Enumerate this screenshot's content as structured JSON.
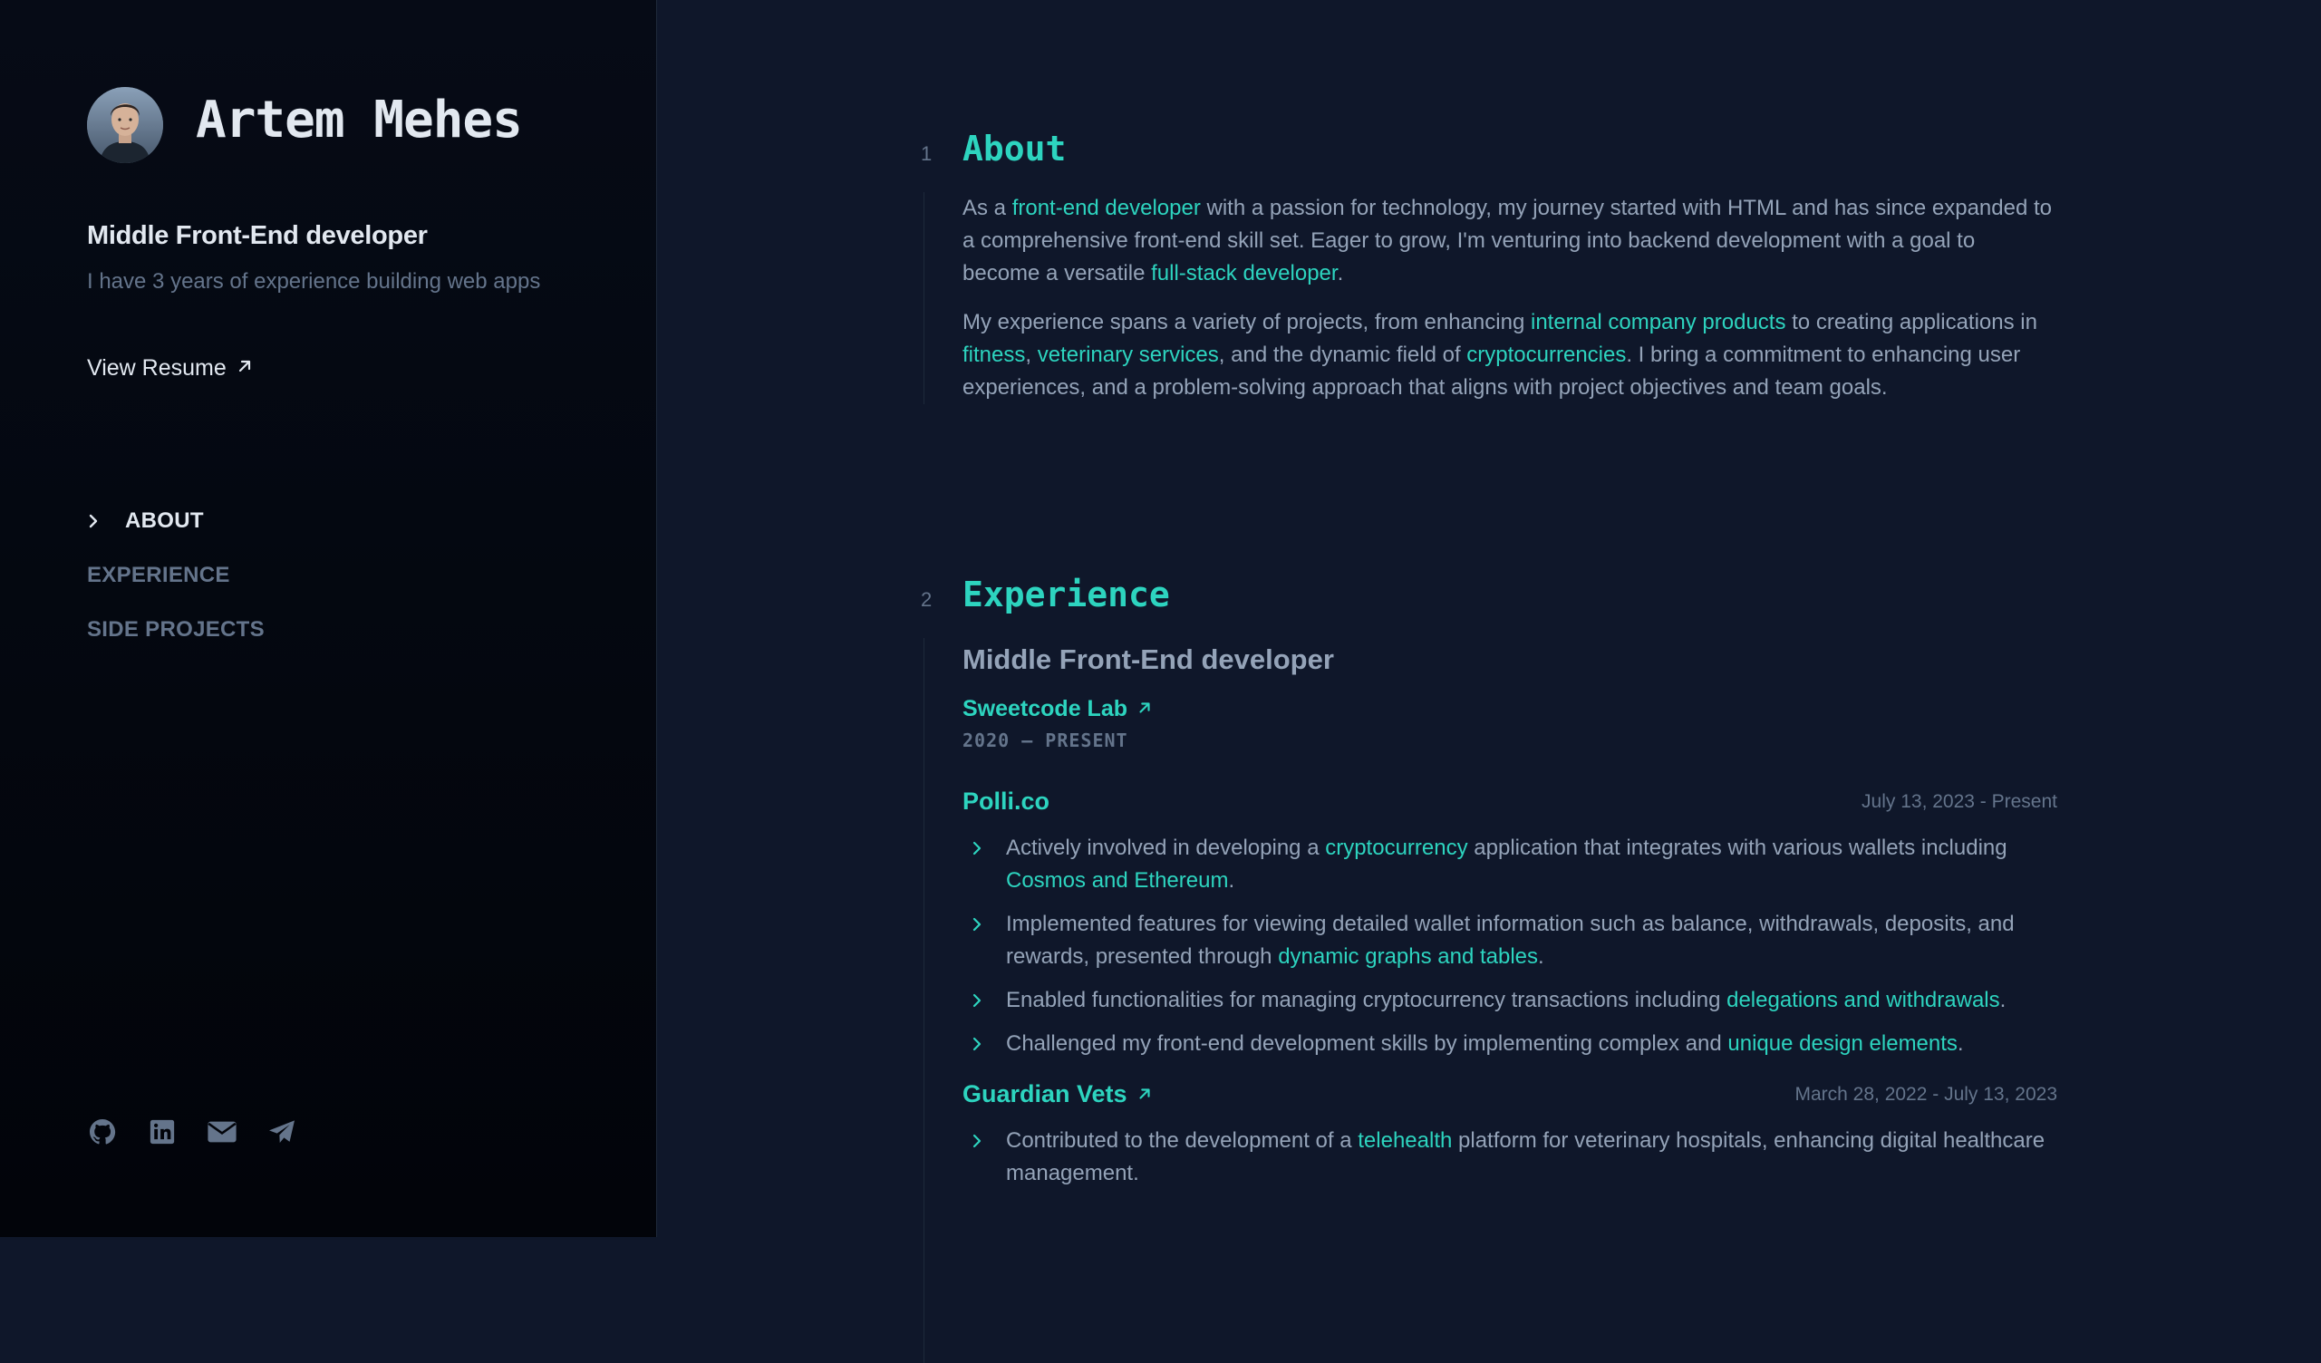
{
  "sidebar": {
    "name": "Artem Mehes",
    "role": "Middle Front-End developer",
    "tagline": "I have 3 years of experience building web apps",
    "resume_label": "View Resume",
    "nav": [
      {
        "label": "ABOUT",
        "active": true
      },
      {
        "label": "EXPERIENCE",
        "active": false
      },
      {
        "label": "SIDE PROJECTS",
        "active": false
      }
    ],
    "socials": [
      "github-icon",
      "linkedin-icon",
      "email-icon",
      "telegram-icon"
    ]
  },
  "about": {
    "number": "1",
    "title": "About",
    "p1": {
      "a": "As a ",
      "b": "front-end developer",
      "c": " with a passion for technology, my journey started with HTML and has since expanded to a comprehensive front-end skill set. Eager to grow, I'm venturing into backend development with a goal to become a versatile ",
      "d": "full-stack developer",
      "e": "."
    },
    "p2": {
      "a": "My experience spans a variety of projects, from enhancing ",
      "b": "internal company products",
      "c": " to creating applications in ",
      "d": "fitness",
      "e": ", ",
      "f": "veterinary services",
      "g": ", and the dynamic field of ",
      "h": "cryptocurrencies",
      "i": ". I bring a commitment to enhancing user experiences, and a problem-solving approach that aligns with project objectives and team goals."
    }
  },
  "experience": {
    "number": "2",
    "title": "Experience",
    "job_title": "Middle Front-End developer",
    "company": "Sweetcode Lab",
    "period": "2020 — PRESENT",
    "projects": [
      {
        "name": "Polli.co",
        "date": "July 13, 2023 - Present",
        "bullets": [
          {
            "a": "Actively involved in developing a ",
            "b": "cryptocurrency",
            "c": " application that integrates with various wallets including ",
            "d": "Cosmos and Ethereum",
            "e": "."
          },
          {
            "a": "Implemented features for viewing detailed wallet information such as balance, withdrawals, deposits, and rewards, presented through ",
            "b": "dynamic graphs and tables",
            "c": "."
          },
          {
            "a": "Enabled functionalities for managing cryptocurrency transactions including ",
            "b": "delegations and withdrawals",
            "c": "."
          },
          {
            "a": "Challenged my front-end development skills by implementing complex and ",
            "b": "unique design elements",
            "c": "."
          }
        ]
      },
      {
        "name": "Guardian Vets",
        "date": "March 28, 2022 - July 13, 2023",
        "bullets": [
          {
            "a": "Contributed to the development of a ",
            "b": "telehealth",
            "c": " platform for veterinary hospitals, enhancing digital healthcare management."
          }
        ]
      }
    ]
  },
  "colors": {
    "accent": "#2dd4bf",
    "bg": "#0f172a",
    "sidebar_bg": "#02040a",
    "text": "#94a3b8",
    "muted": "#64748b",
    "heading": "#e2e8f0"
  }
}
